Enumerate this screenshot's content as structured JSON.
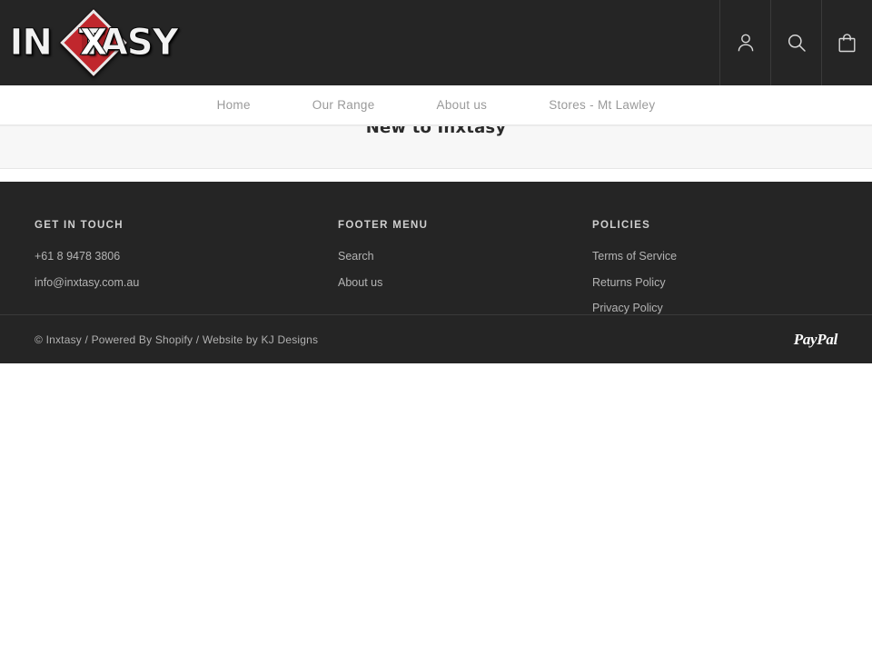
{
  "brand": {
    "logo_text_left": "IN",
    "logo_x": "X",
    "logo_text_right": "TASY",
    "logo_full": "INXTASY",
    "accent_red": "#c0272d",
    "dark_bg": "#252525"
  },
  "header": {
    "icons": [
      {
        "name": "account-icon",
        "label": "Account"
      },
      {
        "name": "search-icon",
        "label": "Search"
      },
      {
        "name": "cart-icon",
        "label": "Cart"
      }
    ]
  },
  "nav": {
    "items": [
      {
        "label": "Home"
      },
      {
        "label": "Our Range"
      },
      {
        "label": "About us"
      },
      {
        "label": "Stores - Mt Lawley"
      }
    ]
  },
  "main": {
    "page_title": "New to Inxtasy"
  },
  "footer": {
    "columns": [
      {
        "heading": "GET IN TOUCH",
        "items": [
          {
            "label": "+61 8 9478 3806"
          },
          {
            "label": "info@inxtasy.com.au"
          }
        ]
      },
      {
        "heading": "FOOTER MENU",
        "items": [
          {
            "label": "Search"
          },
          {
            "label": "About us"
          }
        ]
      },
      {
        "heading": "POLICIES",
        "items": [
          {
            "label": "Terms of Service"
          },
          {
            "label": "Returns Policy"
          },
          {
            "label": "Privacy Policy"
          }
        ]
      }
    ],
    "copyright": "© Inxtasy / Powered By Shopify / Website by KJ Designs",
    "payment": {
      "label": "PayPal",
      "name": "paypal-logo"
    }
  }
}
